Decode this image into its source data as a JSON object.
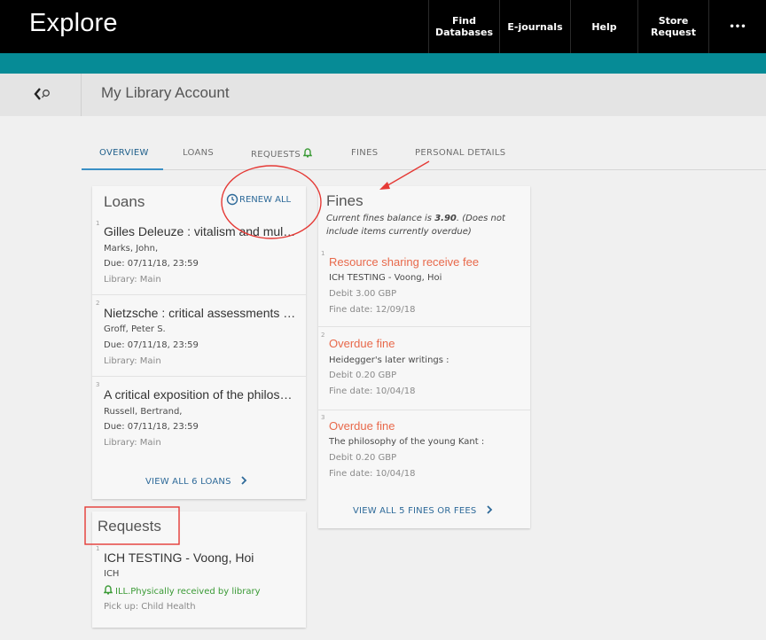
{
  "header": {
    "brand": "Explore",
    "nav": [
      {
        "line1": "Find",
        "line2": "Databases"
      },
      {
        "line1": "E-journals",
        "line2": ""
      },
      {
        "line1": "Help",
        "line2": ""
      },
      {
        "line1": "Store",
        "line2": "Request"
      },
      {
        "line1": "•••",
        "line2": ""
      }
    ]
  },
  "subbar": {
    "title": "My Library Account"
  },
  "tabs": [
    "OVERVIEW",
    "LOANS",
    "REQUESTS",
    "FINES",
    "PERSONAL DETAILS"
  ],
  "loans": {
    "title": "Loans",
    "renew_all": "RENEW ALL",
    "items": [
      {
        "n": "1",
        "title": "Gilles Deleuze : vitalism and multiplicity",
        "author": "Marks, John,",
        "due": "Due: 07/11/18, 23:59",
        "library": "Library: Main"
      },
      {
        "n": "2",
        "title": "Nietzsche : critical assessments / …",
        "author": "Groff, Peter S.",
        "due": "Due: 07/11/18, 23:59",
        "library": "Library: Main"
      },
      {
        "n": "3",
        "title": "A critical exposition of the philos…",
        "author": "Russell, Bertrand,",
        "due": "Due: 07/11/18, 23:59",
        "library": "Library: Main"
      }
    ],
    "view_all": "VIEW ALL 6 LOANS"
  },
  "fines": {
    "title": "Fines",
    "note_prefix": "Current fines balance is ",
    "note_amount": "3.90",
    "note_suffix": ". (Does not",
    "note_line2": "include items currently overdue)",
    "items": [
      {
        "n": "1",
        "type": "Resource sharing receive fee",
        "desc": "ICH TESTING - Voong, Hoi",
        "debit": "Debit 3.00 GBP",
        "date": "Fine date: 12/09/18"
      },
      {
        "n": "2",
        "type": "Overdue fine",
        "desc": "Heidegger's later writings :",
        "debit": "Debit 0.20 GBP",
        "date": "Fine date: 10/04/18"
      },
      {
        "n": "3",
        "type": "Overdue fine",
        "desc": "The philosophy of the young Kant :",
        "debit": "Debit 0.20 GBP",
        "date": "Fine date: 10/04/18"
      }
    ],
    "view_all": "VIEW ALL 5 FINES OR FEES"
  },
  "requests": {
    "title": "Requests",
    "items": [
      {
        "n": "1",
        "title": "ICH TESTING - Voong, Hoi",
        "code": "ICH",
        "status": "ILL.Physically received by library",
        "pickup": "Pick up: Child Health"
      }
    ]
  },
  "colors": {
    "accent": "#068b96",
    "link": "#2e6a99",
    "fee": "#e8694b",
    "annotation": "#e53935",
    "status_green": "#3a9a35"
  },
  "icons": [
    "back-arrow-icon",
    "search-icon",
    "bell-icon",
    "renew-icon",
    "chevron-right-icon"
  ]
}
